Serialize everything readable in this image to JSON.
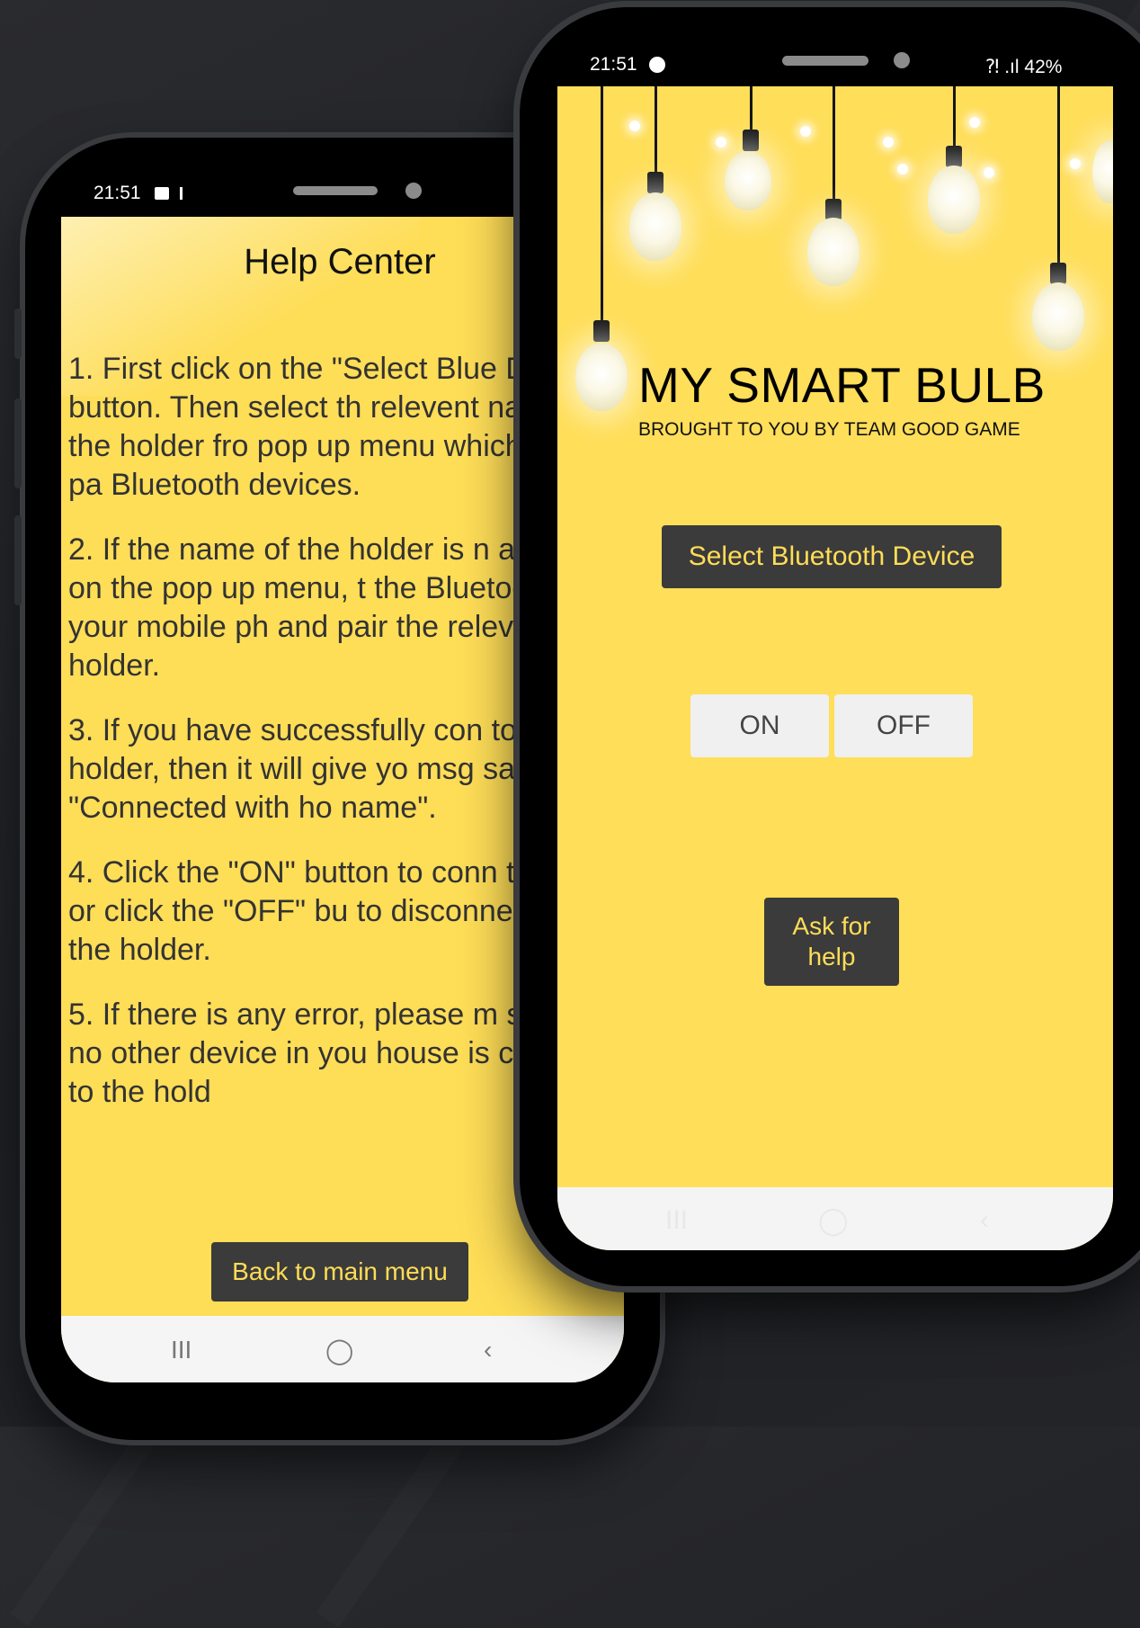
{
  "help_phone": {
    "status": {
      "time": "21:51"
    },
    "title": "Help Center",
    "paragraphs": [
      "1. First click on the \"Select Blue Device\"  button. Then select th relevent name of the holder fro pop up menu which has the pa Bluetooth devices.",
      "2. If the name of the holder is n available on the pop up menu, t the Bluetooth of your mobile ph and pair the relevant holder.",
      "3. If you have successfully con to the holder, then it will give yo msg saying \"Connected with ho name\".",
      "4. Click the \"ON\" button to conn the holder  or click the \"OFF\" bu to disconnect from the holder.",
      "5. If there is any error, please m sure that no other device in you house is connected to the hold"
    ],
    "back_button": "Back to main menu",
    "nav": {
      "recents": "III",
      "home": "◯",
      "back": "‹"
    }
  },
  "main_phone": {
    "status": {
      "time": "21:51",
      "signal": "⁈ .ıl 42%"
    },
    "title": "MY SMART BULB",
    "subtitle": "BROUGHT TO YOU BY TEAM GOOD GAME",
    "select_button": "Select Bluetooth Device",
    "on_button": "ON",
    "off_button": "OFF",
    "help_button": "Ask for help",
    "nav": {
      "recents": "III",
      "home": "◯",
      "back": "‹"
    }
  },
  "colors": {
    "screen_bg": "#ffde59",
    "button_bg": "#3b3b3b",
    "button_text": "#fedd57"
  }
}
